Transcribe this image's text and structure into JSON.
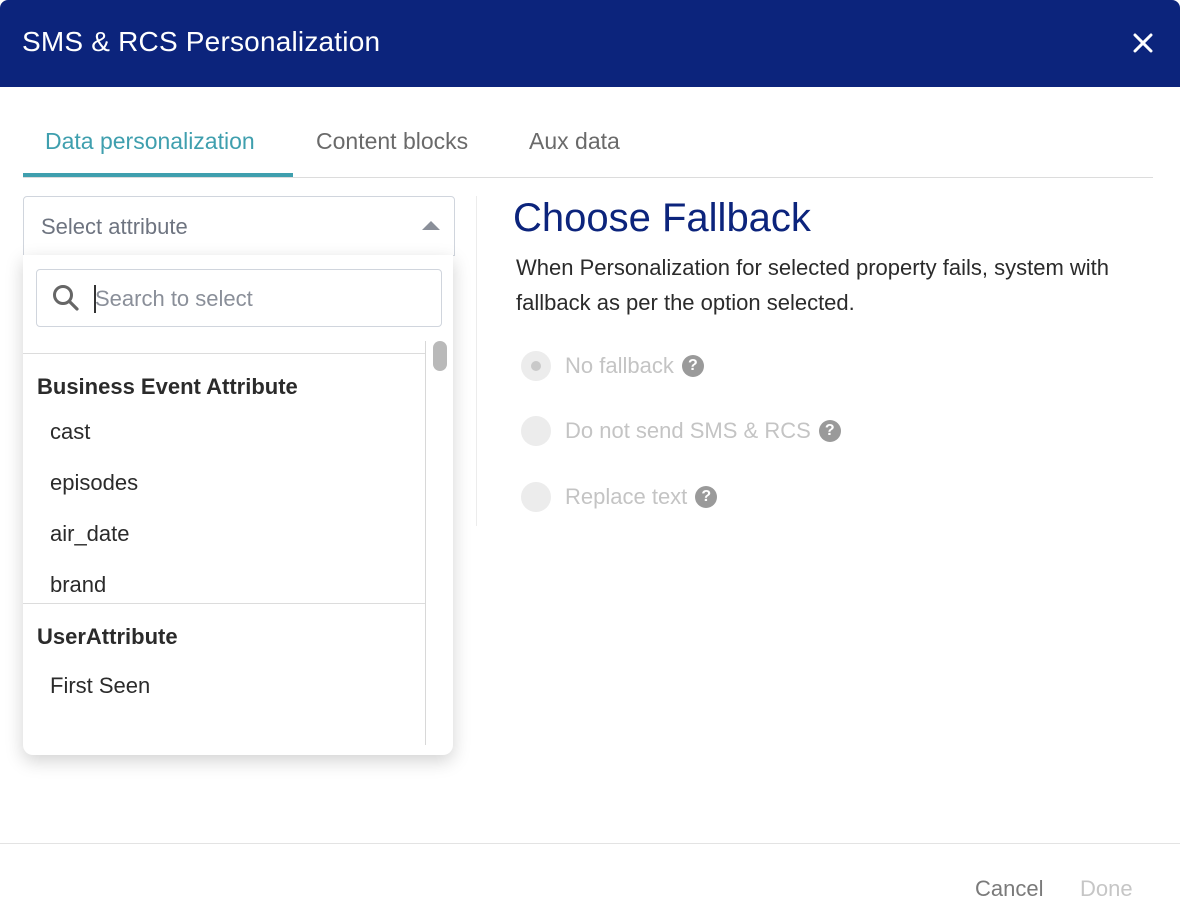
{
  "header": {
    "title": "SMS & RCS Personalization",
    "close_icon": "close-icon"
  },
  "tabs": [
    {
      "label": "Data personalization",
      "active": true
    },
    {
      "label": "Content blocks",
      "active": false
    },
    {
      "label": "Aux data",
      "active": false
    }
  ],
  "attribute_select": {
    "placeholder": "Select attribute",
    "search_placeholder": "Search to select",
    "groups": [
      {
        "title": "Business Event Attribute",
        "options": [
          "cast",
          "episodes",
          "air_date",
          "brand"
        ]
      },
      {
        "title": "UserAttribute",
        "options": [
          "First Seen"
        ]
      }
    ]
  },
  "fallback": {
    "title": "Choose Fallback",
    "description": "When Personalization for selected property fails, system with fallback as per the option selected.",
    "options": [
      {
        "label": "No fallback",
        "checked": true
      },
      {
        "label": "Do not send SMS & RCS",
        "checked": false
      },
      {
        "label": "Replace text",
        "checked": false
      }
    ],
    "help_glyph": "?"
  },
  "footer": {
    "cancel_label": "Cancel",
    "done_label": "Done"
  },
  "colors": {
    "header_bg": "#0c247c",
    "accent": "#3f9fae",
    "title": "#0c247c"
  }
}
